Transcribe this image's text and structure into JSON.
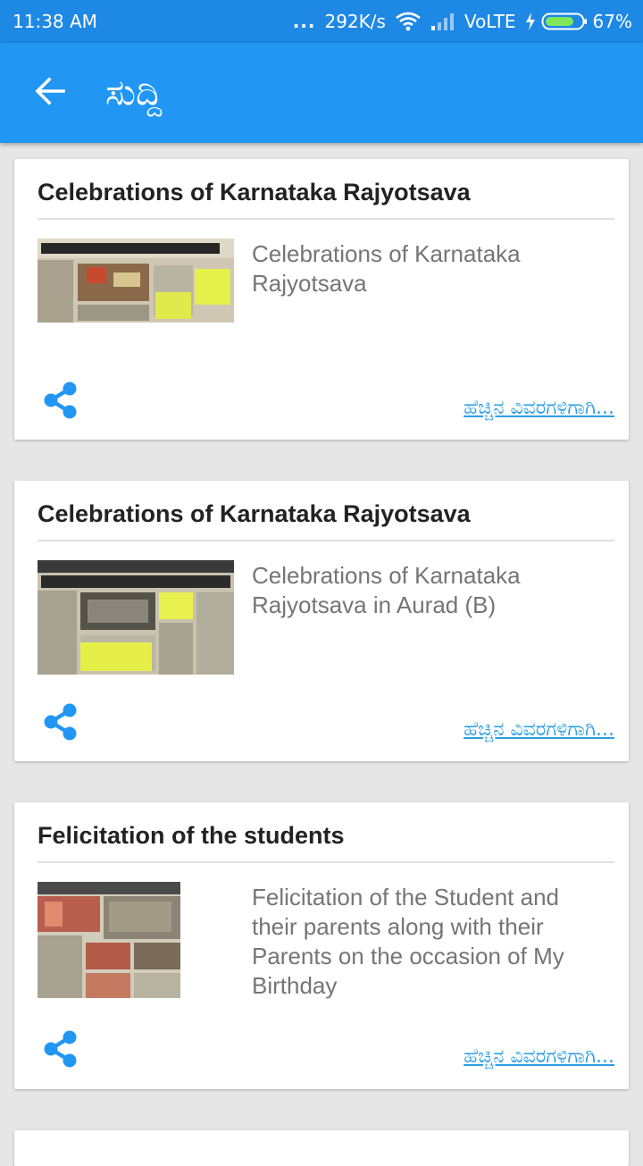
{
  "status_bar": {
    "time": "11:38 AM",
    "dots": "...",
    "speed": "292K/s",
    "network": "VoLTE",
    "battery": "67%"
  },
  "app_bar": {
    "title": "ಸುದ್ದಿ",
    "back_icon": "arrow-left-icon"
  },
  "news": [
    {
      "title": "Celebrations of Karnataka Rajyotsava",
      "description": "Celebrations of Karnataka Rajyotsava",
      "more_label": "ಹೆಚ್ಚಿನ ವಿವರಗಳಿಗಾಗಿ..."
    },
    {
      "title": "Celebrations of Karnataka Rajyotsava",
      "description": "Celebrations of Karnataka Rajyotsava in Aurad (B)",
      "more_label": "ಹೆಚ್ಚಿನ ವಿವರಗಳಿಗಾಗಿ..."
    },
    {
      "title": "Felicitation of the students",
      "description": "Felicitation of the Student and their parents along with their Parents on the occasion of My Birthday",
      "more_label": "ಹೆಚ್ಚಿನ ವಿವರಗಳಿಗಾಗಿ..."
    }
  ],
  "colors": {
    "status_bar": "#1e88e5",
    "app_bar": "#2196f3",
    "share_icon": "#2196f3",
    "link": "#2a9ee6"
  }
}
